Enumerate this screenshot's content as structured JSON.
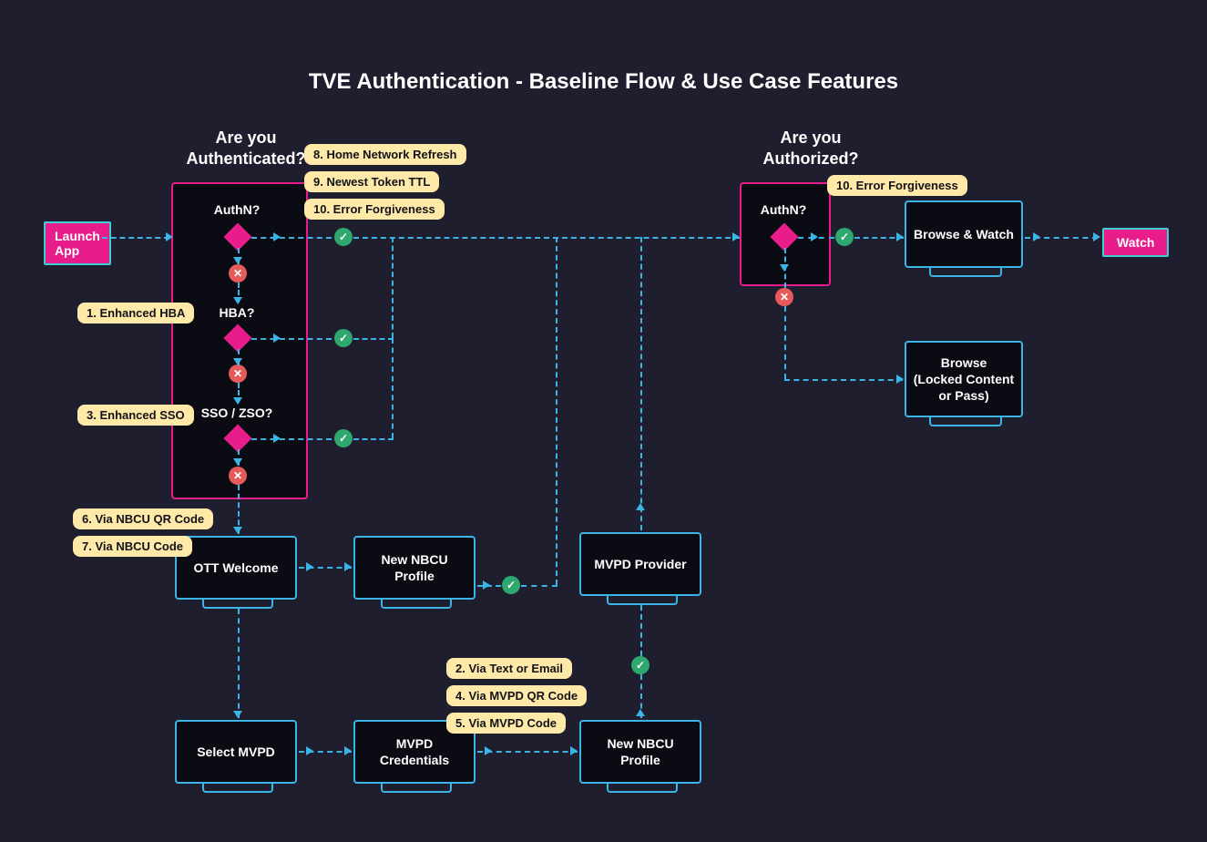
{
  "title": "TVE Authentication - Baseline Flow & Use Case Features",
  "sections": {
    "authn_head": "Are you\nAuthenticated?",
    "authz_head": "Are you\nAuthorized?"
  },
  "actions": {
    "launch": "Launch\nApp",
    "watch": "Watch"
  },
  "questions": {
    "authn": "AuthN?",
    "hba": "HBA?",
    "sso": "SSO / ZSO?",
    "authz_authn": "AuthN?"
  },
  "tvs": {
    "ott_welcome": "OTT Welcome",
    "new_profile_a": "New NBCU Profile",
    "mvpd_provider": "MVPD Provider",
    "select_mvpd": "Select MVPD",
    "mvpd_credentials": "MVPD Credentials",
    "new_profile_b": "New NBCU Profile",
    "browse_watch": "Browse & Watch",
    "browse_locked": "Browse\n(Locked Content\nor Pass)"
  },
  "tags": {
    "t1": "1. Enhanced HBA",
    "t2": "2. Via Text or Email",
    "t3": "3. Enhanced SSO",
    "t4": "4. Via MVPD QR Code",
    "t5": "5. Via MVPD Code",
    "t6": "6. Via NBCU QR Code",
    "t7": "7. Via NBCU Code",
    "t8": "8. Home Network Refresh",
    "t9": "9. Newest Token TTL",
    "t10a": "10. Error Forgiveness",
    "t10b": "10. Error Forgiveness"
  },
  "icons": {
    "check": "✓",
    "cross": "✕"
  }
}
